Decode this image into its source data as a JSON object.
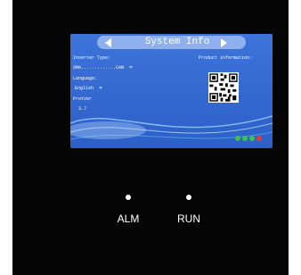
{
  "screen": {
    "title": "System Info",
    "inverter_type_label": "Inverter Type:",
    "inverter_type_value": "SMA.............CAN",
    "language_label": "Language:",
    "language_value": "English",
    "protver_label": "ProtVer",
    "protver_value": "3.7",
    "product_info_label": "Product information:",
    "status_dots": [
      "#3cc24a",
      "#3cc24a",
      "#3cc24a",
      "#e23b3b"
    ]
  },
  "indicators": [
    {
      "label": "ALM"
    },
    {
      "label": "RUN"
    }
  ]
}
